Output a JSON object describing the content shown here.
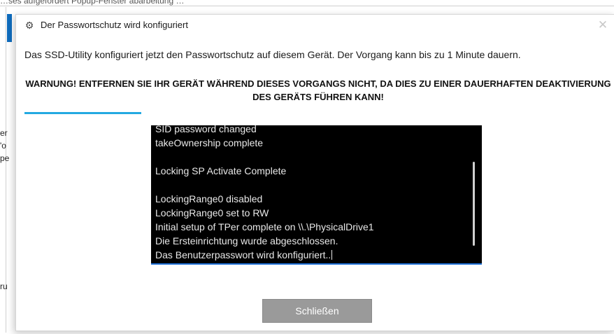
{
  "background": {
    "top_text": "…ses aufgefordert Popup-Fenster abarbeitung …",
    "fragments": [
      "er",
      "'o",
      "pe",
      "ru"
    ]
  },
  "dialog": {
    "icon": "gear-icon",
    "title": "Der Passwortschutz wird konfiguriert",
    "close_symbol": "✕",
    "info": "Das SSD-Utility konfiguriert jetzt den Passwortschutz auf diesem Gerät. Der Vorgang kann bis zu 1 Minute dauern.",
    "warning": "WARNUNG! ENTFERNEN SIE IHR GERÄT WÄHREND DIESES VORGANGS NICHT, DA DIES ZU EINER DAUERHAFTEN DEAKTIVIERUNG DES GERÄTS FÜHREN KANN!",
    "progress": 0.2,
    "progress_color": "#23a9e1",
    "log_lines": [
      "SID password changed",
      "takeOwnership complete",
      "",
      "Locking SP Activate Complete",
      "",
      "LockingRange0 disabled",
      "LockingRange0 set to RW",
      "Initial setup of TPer complete on \\\\.\\PhysicalDrive1",
      "Die Ersteinrichtung wurde abgeschlossen.",
      "Das Benutzerpasswort wird konfiguriert.."
    ],
    "close_button_label": "Schließen"
  }
}
